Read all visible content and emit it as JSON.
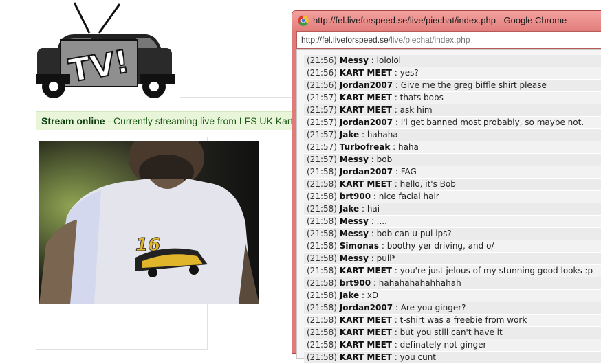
{
  "logo": {
    "text": "TV!"
  },
  "status": {
    "state": "Stream online",
    "message": " - Currently streaming live from LFS UK Kart Meet"
  },
  "browser": {
    "title": "http://fel.liveforspeed.se/live/piechat/index.php - Google Chrome",
    "url_host": "http://fel.liveforspeed.se",
    "url_path": "/live/piechat/index.php"
  },
  "chat": {
    "messages": [
      {
        "time": "(21:56)",
        "user": "Messy",
        "text": " : lololol"
      },
      {
        "time": "(21:56)",
        "user": "KART MEET",
        "text": " : yes?"
      },
      {
        "time": "(21:56)",
        "user": "Jordan2007",
        "text": " : Give me the greg biffle shirt please"
      },
      {
        "time": "(21:57)",
        "user": "KART MEET",
        "text": " : thats bobs"
      },
      {
        "time": "(21:57)",
        "user": "KART MEET",
        "text": " : ask him"
      },
      {
        "time": "(21:57)",
        "user": "Jordan2007",
        "text": " : I'l get banned most probably, so maybe not."
      },
      {
        "time": "(21:57)",
        "user": "Jake",
        "text": " : hahaha"
      },
      {
        "time": "(21:57)",
        "user": "Turbofreak",
        "text": " : haha"
      },
      {
        "time": "(21:57)",
        "user": "Messy",
        "text": " : bob"
      },
      {
        "time": "(21:58)",
        "user": "Jordan2007",
        "text": " : FAG"
      },
      {
        "time": "(21:58)",
        "user": "KART MEET",
        "text": " : hello, it's Bob"
      },
      {
        "time": "(21:58)",
        "user": "brt900",
        "text": " : nice facial hair"
      },
      {
        "time": "(21:58)",
        "user": "Jake",
        "text": " : hai"
      },
      {
        "time": "(21:58)",
        "user": "Messy",
        "text": " : ...."
      },
      {
        "time": "(21:58)",
        "user": "Messy",
        "text": " : bob can u pul ips?"
      },
      {
        "time": "(21:58)",
        "user": "Simonas",
        "text": " : boothy yer driving, and o/"
      },
      {
        "time": "(21:58)",
        "user": "Messy",
        "text": " : pull*"
      },
      {
        "time": "(21:58)",
        "user": "KART MEET",
        "text": " : you're just jelous of my stunning good looks :p"
      },
      {
        "time": "(21:58)",
        "user": "brt900",
        "text": " : hahahahahahhahah"
      },
      {
        "time": "(21:58)",
        "user": "Jake",
        "text": " : xD"
      },
      {
        "time": "(21:58)",
        "user": "Jordan2007",
        "text": " : Are you ginger?"
      },
      {
        "time": "(21:58)",
        "user": "KART MEET",
        "text": " : t-shirt was a freebie from work"
      },
      {
        "time": "(21:58)",
        "user": "KART MEET",
        "text": " : but you still can't have it"
      },
      {
        "time": "(21:58)",
        "user": "KART MEET",
        "text": " : definately not ginger"
      },
      {
        "time": "(21:58)",
        "user": "KART MEET",
        "text": " : you cunt"
      }
    ]
  },
  "video": {
    "shirt_number": "16"
  }
}
